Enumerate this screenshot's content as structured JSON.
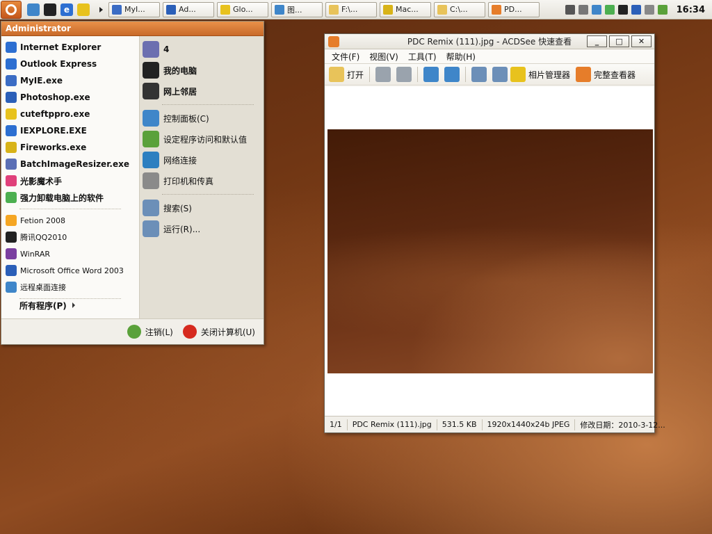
{
  "taskbar": {
    "tasks": [
      {
        "label": "MyI...",
        "color": "#3b6cc4"
      },
      {
        "label": "Ad...",
        "color": "#2b5fb8"
      },
      {
        "label": "Glo...",
        "color": "#e8c21d"
      },
      {
        "label": "图...",
        "color": "#3f86c9"
      },
      {
        "label": "F:\\...",
        "color": "#e8c35a"
      },
      {
        "label": "Mac...",
        "color": "#d8b318"
      },
      {
        "label": "C:\\...",
        "color": "#e8c35a"
      },
      {
        "label": "PD...",
        "color": "#e67d2a"
      }
    ],
    "clock": "16:34"
  },
  "start_menu": {
    "user": "Administrator",
    "pinned": [
      {
        "label": "Internet Explorer",
        "icon": "internet-explorer-icon",
        "color": "#2d6fd1"
      },
      {
        "label": "Outlook Express",
        "icon": "outlook-express-icon",
        "color": "#2d6fd1"
      },
      {
        "label": "MyIE.exe",
        "icon": "myie-icon",
        "color": "#3b6cc4"
      },
      {
        "label": "Photoshop.exe",
        "icon": "photoshop-icon",
        "color": "#2b5fb8"
      },
      {
        "label": "cuteftppro.exe",
        "icon": "cuteftp-icon",
        "color": "#e8c21d"
      },
      {
        "label": "IEXPLORE.EXE",
        "icon": "internet-explorer-icon",
        "color": "#2d6fd1"
      },
      {
        "label": "Fireworks.exe",
        "icon": "fireworks-icon",
        "color": "#d8b318"
      },
      {
        "label": "BatchImageResizer.exe",
        "icon": "image-resizer-icon",
        "color": "#5b6fb5"
      },
      {
        "label": "光影魔术手",
        "icon": "nikon-icon",
        "color": "#e0407a"
      },
      {
        "label": "强力卸载电脑上的软件",
        "icon": "uninstall-icon",
        "color": "#4caf50"
      }
    ],
    "recent": [
      {
        "label": "Fetion 2008",
        "icon": "fetion-icon",
        "color": "#f5a623"
      },
      {
        "label": "腾讯QQ2010",
        "icon": "qq-icon",
        "color": "#222222"
      },
      {
        "label": "WinRAR",
        "icon": "winrar-icon",
        "color": "#7b3fa0"
      },
      {
        "label": "Microsoft Office Word 2003",
        "icon": "word-icon",
        "color": "#2b5fb8"
      },
      {
        "label": "远程桌面连接",
        "icon": "remote-desktop-icon",
        "color": "#3f86c9"
      }
    ],
    "all_programs": "所有程序(P)",
    "right_top": [
      {
        "label": "4",
        "icon": "user-folder-icon",
        "color": "#6c6fb0"
      },
      {
        "label": "我的电脑",
        "icon": "my-computer-icon",
        "color": "#222222"
      },
      {
        "label": "网上邻居",
        "icon": "network-places-icon",
        "color": "#333333"
      }
    ],
    "right_mid": [
      {
        "label": "控制面板(C)",
        "icon": "control-panel-icon",
        "color": "#3f86c9"
      },
      {
        "label": "设定程序访问和默认值",
        "icon": "default-programs-icon",
        "color": "#5aa13a"
      },
      {
        "label": "网络连接",
        "icon": "network-connections-icon",
        "color": "#2d7fc0"
      },
      {
        "label": "打印机和传真",
        "icon": "printer-icon",
        "color": "#8a8a8a"
      }
    ],
    "right_bottom": [
      {
        "label": "搜索(S)",
        "icon": "search-icon",
        "color": "#6c8fb8"
      },
      {
        "label": "运行(R)...",
        "icon": "run-icon",
        "color": "#6c8fb8"
      }
    ],
    "logoff": "注销(L)",
    "shutdown": "关闭计算机(U)"
  },
  "viewer": {
    "title": "PDC Remix (111).jpg - ACDSee 快速查看",
    "menu": [
      "文件(F)",
      "视图(V)",
      "工具(T)",
      "帮助(H)"
    ],
    "toolbar": {
      "open": "打开",
      "photo_manager": "相片管理器",
      "full_viewer": "完整查看器"
    },
    "status": {
      "index": "1/1",
      "filename": "PDC Remix (111).jpg",
      "size": "531.5 KB",
      "dimensions": "1920x1440x24b JPEG",
      "modified": "修改日期：2010-3-12..."
    }
  },
  "colors": {
    "accent": "#c96a29",
    "desktop": "#7e3f18"
  }
}
